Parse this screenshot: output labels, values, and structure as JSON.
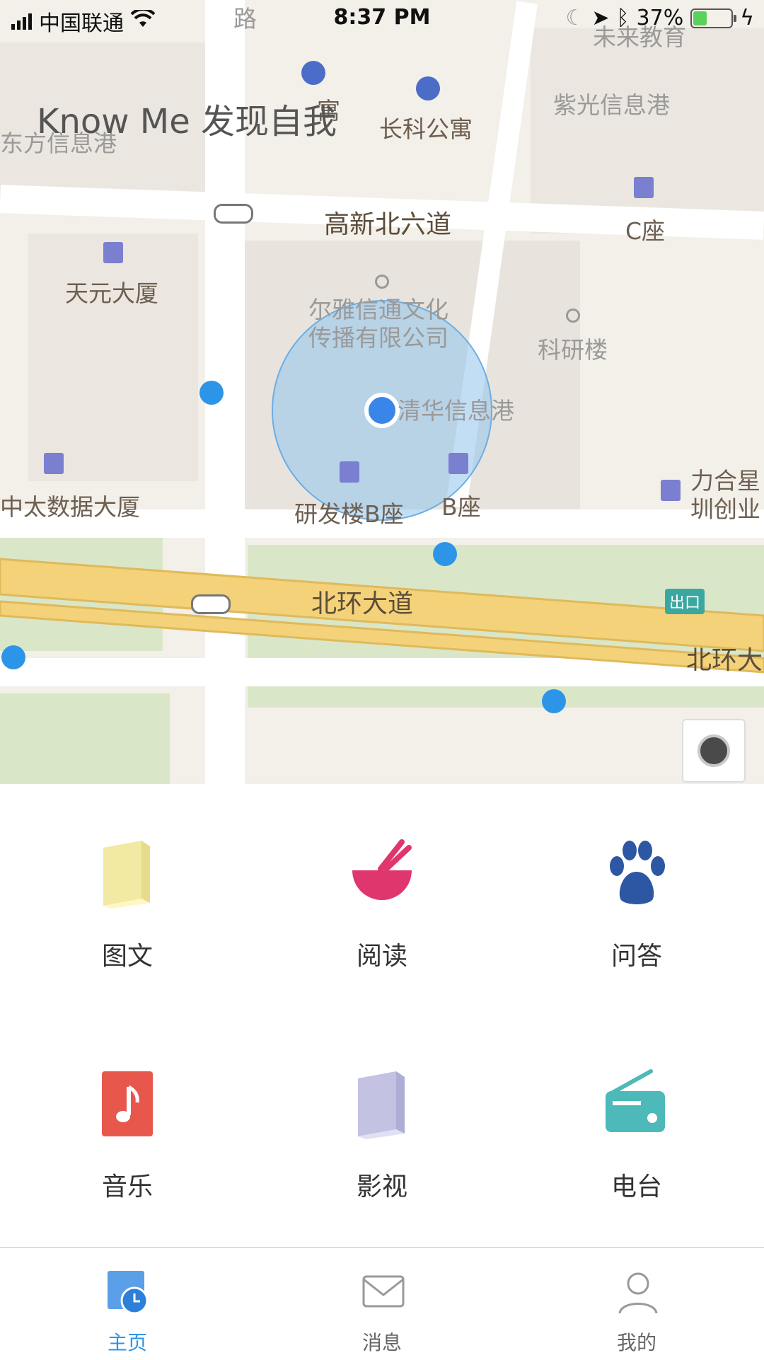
{
  "status_bar": {
    "carrier": "中国联通",
    "time": "8:37 PM",
    "battery_percent": "37%",
    "battery_level": 0.37
  },
  "app_title": "Know Me 发现自我",
  "map": {
    "labels": {
      "road_top": "路",
      "future_edu": "未来教育",
      "apartment_guest": "寓",
      "apartment_changke": "长科公寓",
      "dongfang": "东方信息港",
      "ziguang": "紫光信息港",
      "gaoxin_road": "高新北六道",
      "c_building": "C座",
      "tianyuan": "天元大厦",
      "erya": "尔雅信通文化\n传播有限公司",
      "keyan": "科研楼",
      "tsinghua": "清华信息港",
      "lihe": "力合星\n圳创业",
      "zhongtai": "中太数据大厦",
      "yanfa_b": "研发楼B座",
      "b_building": "B座",
      "beihuan": "北环大道",
      "beihuan_right": "北环大",
      "exit": "出口"
    }
  },
  "grid": [
    {
      "label": "图文",
      "icon": "book-icon",
      "color": "#f2e9a3"
    },
    {
      "label": "阅读",
      "icon": "bowl-icon",
      "color": "#e0366e"
    },
    {
      "label": "问答",
      "icon": "paw-icon",
      "color": "#2d57a3"
    },
    {
      "label": "音乐",
      "icon": "music-note-icon",
      "color": "#e8574b"
    },
    {
      "label": "影视",
      "icon": "book-icon",
      "color": "#c3c2e3"
    },
    {
      "label": "电台",
      "icon": "radio-icon",
      "color": "#4dbab9"
    }
  ],
  "tabs": [
    {
      "label": "主页",
      "icon": "home-clock-icon",
      "active": true
    },
    {
      "label": "消息",
      "icon": "mail-icon",
      "active": false
    },
    {
      "label": "我的",
      "icon": "person-icon",
      "active": false
    }
  ]
}
